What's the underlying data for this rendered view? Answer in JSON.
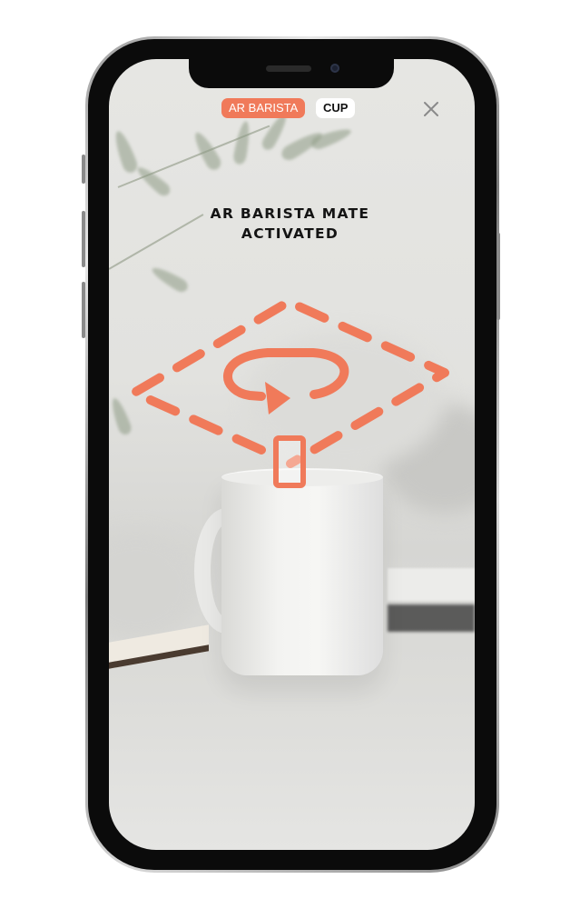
{
  "app": {
    "mode_chip": "AR BARISTA",
    "object_chip": "CUP",
    "close_icon": "close-icon"
  },
  "instruction": {
    "line1": "AR BARISTA MATE",
    "line2": "ACTIVATED"
  },
  "overlay": {
    "plane_icon": "dashed-plane-icon",
    "rotate_icon": "rotate-arrow-icon",
    "phone_icon": "phone-icon"
  },
  "colors": {
    "accent": "#f07a5a",
    "title_text": "#141414"
  }
}
